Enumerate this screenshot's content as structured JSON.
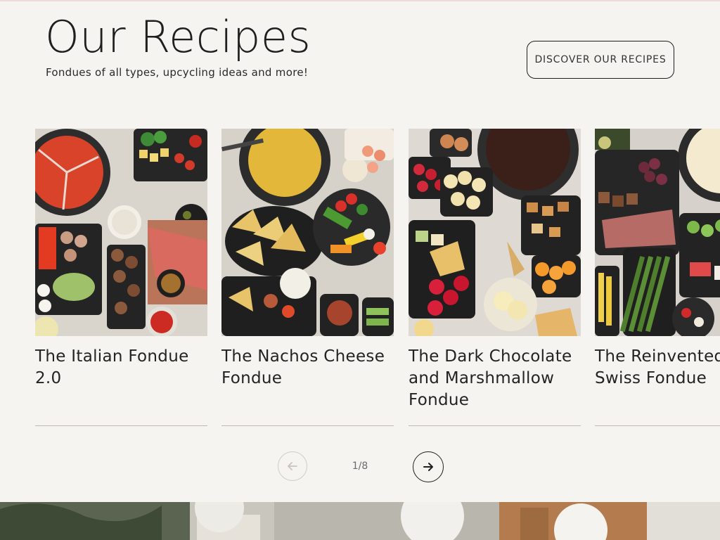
{
  "header": {
    "title": "Our Recipes",
    "subtitle": "Fondues of all types, upcycling ideas and more!",
    "cta_label": "DISCOVER OUR RECIPES"
  },
  "recipes": [
    {
      "name": "The Italian Fondue 2.0"
    },
    {
      "name": "The Nachos Cheese Fondue"
    },
    {
      "name": "The Dark Chocolate and Marshmallow Fondue"
    },
    {
      "name": "The Reinvented and Swiss Fondue"
    }
  ],
  "pager": {
    "counter": "1/8",
    "prev_icon": "arrow-left-icon",
    "next_icon": "arrow-right-icon"
  },
  "colors": {
    "background": "#f6f4f0",
    "text": "#1f1f1f",
    "divider": "#bdb9b2",
    "disabled": "#cfcdc8"
  }
}
